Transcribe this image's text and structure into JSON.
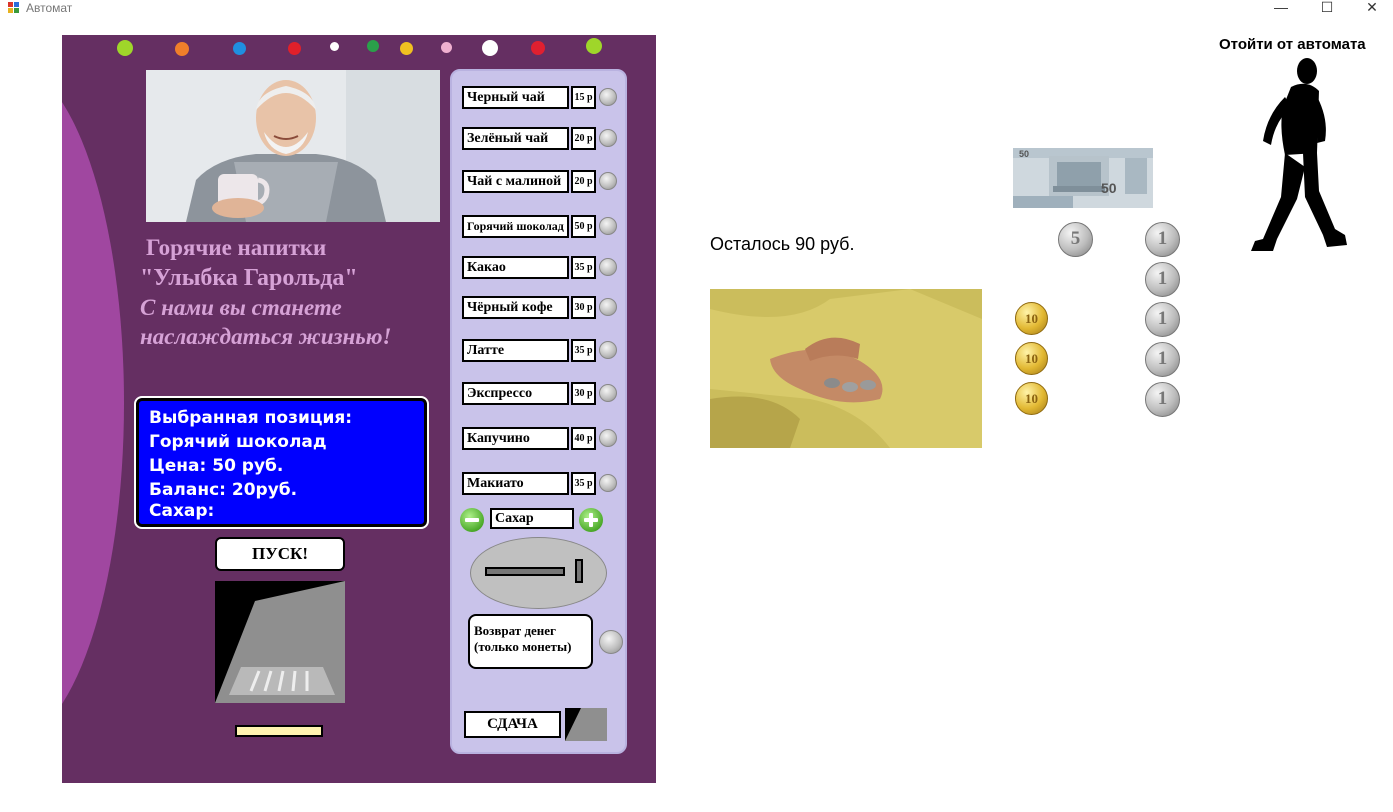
{
  "window": {
    "title": "Автомат",
    "minimize_glyph": "—",
    "maximize_glyph": "☐",
    "close_glyph": "✕"
  },
  "machine": {
    "slogan": {
      "line1": "Горячие напитки",
      "line2": "\"Улыбка Гарольда\"",
      "line3": "С нами вы станете",
      "line4": "наслаждаться жизнью!"
    },
    "lamp_colors": [
      "#9fd62a",
      "#f07f2a",
      "#1f8fe0",
      "#e0202a",
      "#ffffff",
      "#2aa04a",
      "#f0c020",
      "#f0b0d0",
      "#ffffff",
      "#e02030",
      "#9fd62a"
    ],
    "display": {
      "selected_label": "Выбранная позиция:",
      "selected_item": "Горячий шоколад",
      "price": "Цена: 50 руб.",
      "balance": "Баланс: 20руб.",
      "sugar": "Сахар:"
    },
    "start_label": "ПУСК!"
  },
  "menu": [
    {
      "name": "Черный чай",
      "price": "15 р"
    },
    {
      "name": "Зелёный чай",
      "price": "20 р"
    },
    {
      "name": "Чай с малиной",
      "price": "20 р"
    },
    {
      "name": "Горячий шоколад",
      "price": "50 р"
    },
    {
      "name": "Какао",
      "price": "35 р"
    },
    {
      "name": "Чёрный кофе",
      "price": "30 р"
    },
    {
      "name": "Латте",
      "price": "35 р"
    },
    {
      "name": "Экспрессо",
      "price": "30 р"
    },
    {
      "name": "Капучино",
      "price": "40 р"
    },
    {
      "name": "Макиато",
      "price": "35 р"
    }
  ],
  "controls": {
    "sugar_label": "Сахар",
    "refund_line1": "Возврат денег",
    "refund_line2": "(только монеты)",
    "change_label": "СДАЧА"
  },
  "wallet": {
    "remaining": "Осталось 90 руб.",
    "banknote_value": "50",
    "coins": [
      {
        "value": "5",
        "type": "silver"
      },
      {
        "value": "1",
        "type": "silver"
      },
      {
        "value": "1",
        "type": "silver"
      },
      {
        "value": "1",
        "type": "silver"
      },
      {
        "value": "1",
        "type": "silver"
      },
      {
        "value": "1",
        "type": "silver"
      },
      {
        "value": "10",
        "type": "gold"
      },
      {
        "value": "10",
        "type": "gold"
      },
      {
        "value": "10",
        "type": "gold"
      }
    ]
  },
  "walk_away_label": "Отойти от автомата"
}
